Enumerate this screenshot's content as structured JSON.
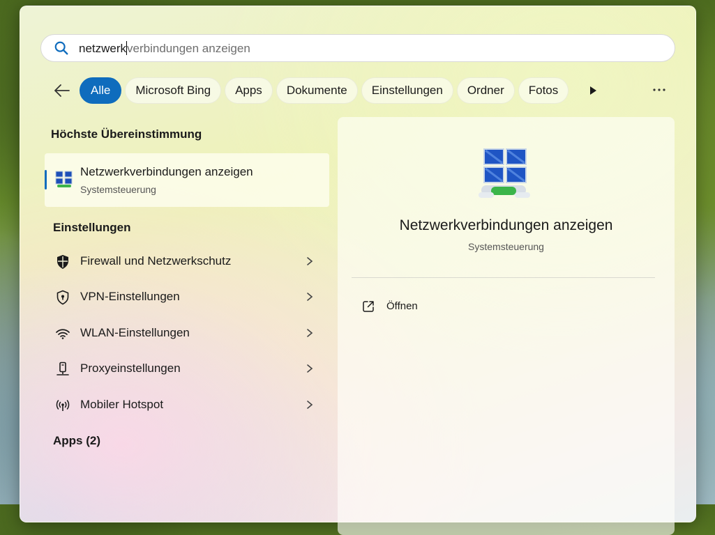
{
  "search": {
    "typed": "netzwerk",
    "suggestion": "verbindungen anzeigen"
  },
  "filters": {
    "chips": [
      "Alle",
      "Microsoft Bing",
      "Apps",
      "Dokumente",
      "Einstellungen",
      "Ordner",
      "Fotos"
    ],
    "active": "Alle"
  },
  "best_match": {
    "section_title": "Höchste Übereinstimmung",
    "title": "Netzwerkverbindungen anzeigen",
    "subtitle": "Systemsteuerung"
  },
  "settings": {
    "section_title": "Einstellungen",
    "items": [
      {
        "label": "Firewall und Netzwerkschutz",
        "icon": "shield-icon"
      },
      {
        "label": "VPN-Einstellungen",
        "icon": "vpn-shield-icon"
      },
      {
        "label": "WLAN-Einstellungen",
        "icon": "wifi-icon"
      },
      {
        "label": "Proxyeinstellungen",
        "icon": "proxy-icon"
      },
      {
        "label": "Mobiler Hotspot",
        "icon": "hotspot-icon"
      }
    ]
  },
  "apps": {
    "section_title": "Apps (2)"
  },
  "detail": {
    "title": "Netzwerkverbindungen anzeigen",
    "subtitle": "Systemsteuerung",
    "actions": [
      {
        "label": "Öffnen",
        "icon": "open-external-icon"
      }
    ]
  },
  "colors": {
    "accent": "#0f6cbd"
  }
}
